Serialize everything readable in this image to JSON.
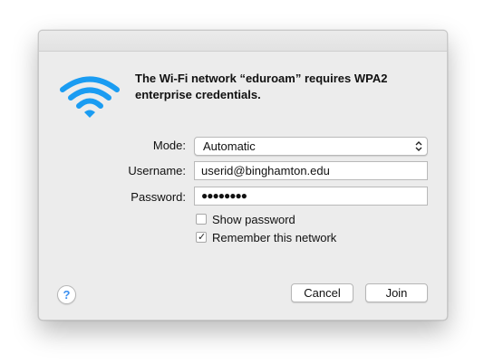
{
  "dialog": {
    "message": "The Wi-Fi network “eduroam” requires WPA2 enterprise credentials.",
    "icon": "wifi-icon",
    "accent_color": "#1a9cf2"
  },
  "form": {
    "mode_label": "Mode:",
    "mode_value": "Automatic",
    "username_label": "Username:",
    "username_value": "userid@binghamton.edu",
    "password_label": "Password:",
    "password_value": "●●●●●●●●"
  },
  "options": {
    "show_password_label": "Show password",
    "show_password_checked": false,
    "remember_label": "Remember this network",
    "remember_checked": true,
    "check_glyph": "✓"
  },
  "buttons": {
    "help_label": "?",
    "cancel_label": "Cancel",
    "join_label": "Join"
  }
}
